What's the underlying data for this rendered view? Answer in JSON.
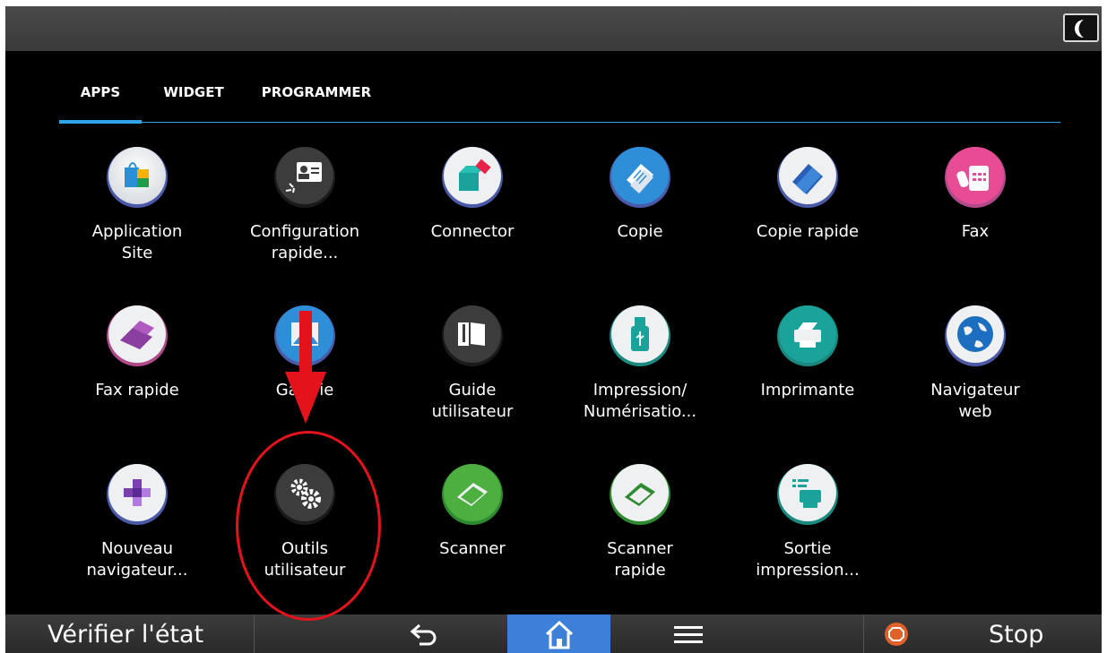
{
  "topbar": {
    "sleep_icon": "moon-icon"
  },
  "tabs": [
    {
      "label": "APPS",
      "active": true
    },
    {
      "label": "WIDGET",
      "active": false
    },
    {
      "label": "PROGRAMMER",
      "active": false
    }
  ],
  "apps": [
    {
      "label": "Application\nSite",
      "icon": "shopping-bag-icon"
    },
    {
      "label": "Configuration\nrapide...",
      "icon": "id-card-icon"
    },
    {
      "label": "Connector",
      "icon": "connector-icon"
    },
    {
      "label": "Copie",
      "icon": "copy-icon"
    },
    {
      "label": "Copie rapide",
      "icon": "quick-copy-icon"
    },
    {
      "label": "Fax",
      "icon": "fax-icon"
    },
    {
      "label": "Fax rapide",
      "icon": "quick-fax-icon"
    },
    {
      "label": "Galerie",
      "icon": "gallery-icon"
    },
    {
      "label": "Guide\nutilisateur",
      "icon": "book-icon"
    },
    {
      "label": "Impression/\nNumérisatio...",
      "icon": "usb-icon"
    },
    {
      "label": "Imprimante",
      "icon": "printer-icon"
    },
    {
      "label": "Navigateur\nweb",
      "icon": "globe-icon"
    },
    {
      "label": "Nouveau\nnavigateur...",
      "icon": "new-browser-icon"
    },
    {
      "label": "Outils\nutilisateur",
      "icon": "gears-icon"
    },
    {
      "label": "Scanner",
      "icon": "scanner-icon"
    },
    {
      "label": "Scanner\nrapide",
      "icon": "quick-scanner-icon"
    },
    {
      "label": "Sortie\nimpression...",
      "icon": "print-output-icon"
    }
  ],
  "bottombar": {
    "status_label": "Vérifier l'état",
    "stop_label": "Stop"
  },
  "colors": {
    "accent": "#2fa4e7",
    "home_active": "#3d7fd9",
    "annotation": "#e4121a",
    "stop": "#e0602a"
  }
}
